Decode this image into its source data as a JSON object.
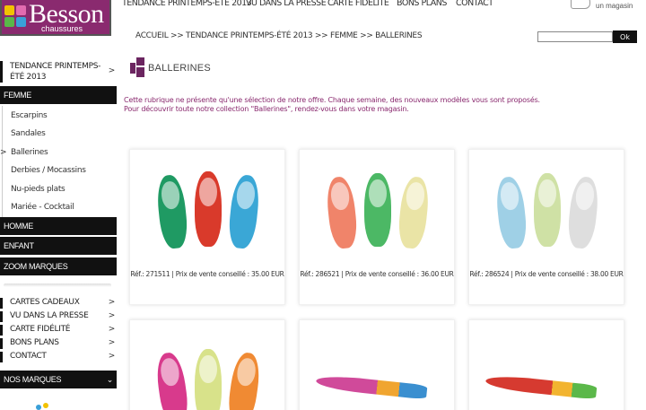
{
  "brand": {
    "name": "Besson",
    "sub": "chaussures"
  },
  "topnav": [
    "TENDANCE PRINTEMPS-ÉTÉ 2013",
    "VU DANS LA PRESSE",
    "CARTE FIDÉLITÉ",
    "BONS PLANS",
    "CONTACT"
  ],
  "store_locator": "un magasin",
  "breadcrumb": "ACCUEIL >> TENDANCE PRINTEMPS-ÉTÉ 2013 >> FEMME >> BALLERINES",
  "search": {
    "placeholder": "",
    "button": "Ok"
  },
  "sidebar": {
    "trend": "TENDANCE PRINTEMPS-ÉTÉ 2013",
    "femme": "FEMME",
    "femme_items": [
      "Escarpins",
      "Sandales",
      "Ballerines",
      "Derbies / Mocassins",
      "Nu-pieds plats",
      "Mariée - Cocktail"
    ],
    "femme_selected": "Ballerines",
    "homme": "HOMME",
    "enfant": "ENFANT",
    "zoom": "ZOOM MARQUES",
    "links": [
      "CARTES CADEAUX",
      "VU DANS LA PRESSE",
      "CARTE FIDÉLITÉ",
      "BONS PLANS",
      "CONTACT"
    ],
    "brands": "NOS MARQUES"
  },
  "section_title": "BALLERINES",
  "intro": [
    "Cette rubrique ne présente qu'une sélection de notre offre. Chaque semaine, des nouveaux modèles vous sont proposés.",
    "Pour découvrir toute notre collection \"Ballerines\", rendez-vous dans votre magasin."
  ],
  "products": [
    {
      "caption": "Réf.: 271511 | Prix de vente conseillé : 35.00 EUR",
      "colors": [
        "#1f9a63",
        "#d93a2b",
        "#3aa7d6"
      ]
    },
    {
      "caption": "Réf.: 286521 | Prix de vente conseillé : 36.00 EUR",
      "colors": [
        "#f0846a",
        "#4cb865",
        "#eae4a6"
      ]
    },
    {
      "caption": "Réf.: 286524 | Prix de vente conseillé : 38.00 EUR",
      "colors": [
        "#9fd0e6",
        "#cfe1a5",
        "#dedede"
      ]
    },
    {
      "caption": "",
      "colors": [
        "#d83a8c",
        "#d8e28a",
        "#f08a33"
      ]
    },
    {
      "caption": "",
      "colors": [
        "#d04a9a",
        "#f0a530",
        "#3a8fd0"
      ]
    },
    {
      "caption": "",
      "colors": [
        "#d63a30",
        "#f2b430",
        "#5bb84a"
      ]
    }
  ]
}
